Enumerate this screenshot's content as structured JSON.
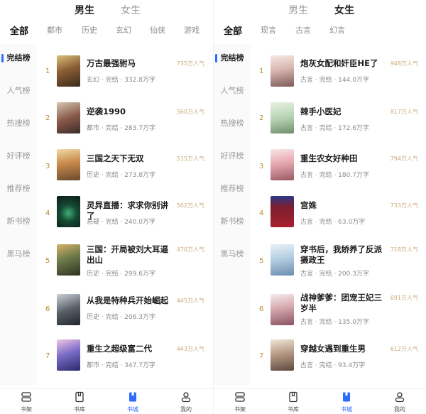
{
  "left": {
    "gender_tabs": [
      "男生",
      "女生"
    ],
    "active_gender": 0,
    "categories": [
      "全部",
      "都市",
      "历史",
      "玄幻",
      "仙侠",
      "游戏"
    ],
    "side_menu": [
      "完结榜",
      "人气榜",
      "热搜榜",
      "好评榜",
      "推荐榜",
      "新书榜",
      "黑马榜"
    ],
    "books": [
      {
        "rank": "1",
        "title": "万古最强驸马",
        "meta": "玄幻 · 完结 · 332.8万字",
        "popularity": "735万人气"
      },
      {
        "rank": "2",
        "title": "逆袭1990",
        "meta": "都市 · 完结 · 283.7万字",
        "popularity": "560万人气"
      },
      {
        "rank": "3",
        "title": "三国之天下无双",
        "meta": "历史 · 完结 · 273.8万字",
        "popularity": "515万人气"
      },
      {
        "rank": "4",
        "title": "灵异直播：求求你别讲了",
        "meta": "悬疑 · 完结 · 240.0万字",
        "popularity": "502万人气"
      },
      {
        "rank": "5",
        "title": "三国：开局被刘大耳逼出山",
        "meta": "历史 · 完结 · 299.6万字",
        "popularity": "470万人气"
      },
      {
        "rank": "6",
        "title": "从我是特种兵开始崛起",
        "meta": "历史 · 完结 · 206.3万字",
        "popularity": "445万人气"
      },
      {
        "rank": "7",
        "title": "重生之超级富二代",
        "meta": "都市 · 完结 · 347.7万字",
        "popularity": "443万人气"
      }
    ]
  },
  "right": {
    "gender_tabs": [
      "男生",
      "女生"
    ],
    "active_gender": 1,
    "categories": [
      "全部",
      "现言",
      "古言",
      "幻言"
    ],
    "side_menu": [
      "完结榜",
      "人气榜",
      "热搜榜",
      "好评榜",
      "推荐榜",
      "新书榜",
      "黑马榜"
    ],
    "books": [
      {
        "rank": "1",
        "title": "炮灰女配和奸臣HE了",
        "meta": "古言 · 完结 · 144.0万字",
        "popularity": "948万人气"
      },
      {
        "rank": "2",
        "title": "辣手小医妃",
        "meta": "古言 · 完结 · 172.6万字",
        "popularity": "817万人气"
      },
      {
        "rank": "3",
        "title": "重生农女好种田",
        "meta": "古言 · 完结 · 180.7万字",
        "popularity": "794万人气"
      },
      {
        "rank": "4",
        "title": "宫姝",
        "meta": "古言 · 完结 · 63.0万字",
        "popularity": "733万人气"
      },
      {
        "rank": "5",
        "title": "穿书后，我娇养了反派摄政王",
        "meta": "古言 · 完结 · 200.3万字",
        "popularity": "718万人气"
      },
      {
        "rank": "6",
        "title": "战神爹爹：团宠王妃三岁半",
        "meta": "古言 · 完结 · 135.0万字",
        "popularity": "691万人气"
      },
      {
        "rank": "7",
        "title": "穿越女遇到重生男",
        "meta": "古言 · 完结 · 93.4万字",
        "popularity": "612万人气"
      }
    ]
  },
  "tabbar": [
    "书架",
    "书库",
    "书城",
    "我的"
  ],
  "active_tab": 2,
  "colors": {
    "accent": "#2e6bff",
    "rank": "#b8902c",
    "popularity": "#c8a979"
  },
  "icons": [
    "bookshelf-icon",
    "library-icon",
    "bookstore-icon",
    "profile-icon"
  ]
}
